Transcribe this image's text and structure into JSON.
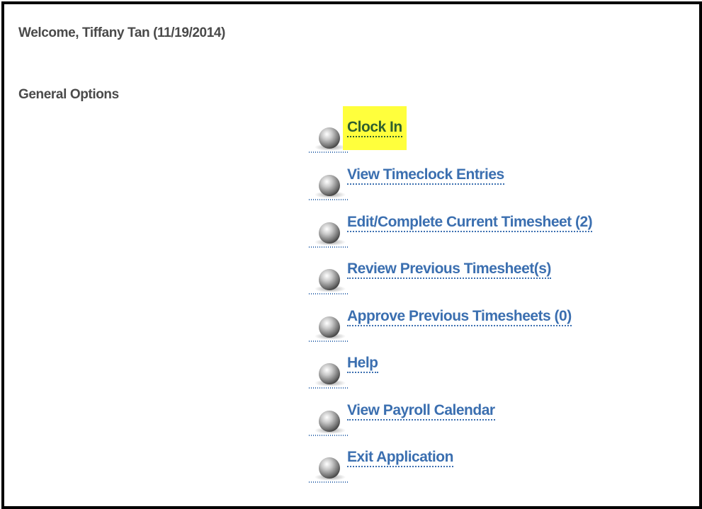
{
  "header": {
    "welcome": "Welcome, Tiffany Tan (11/19/2014)"
  },
  "general_options": {
    "title": "General Options",
    "items": [
      {
        "label": "Clock In",
        "highlighted": true
      },
      {
        "label": "View Timeclock Entries",
        "highlighted": false
      },
      {
        "label": "Edit/Complete Current Timesheet (2)",
        "highlighted": false
      },
      {
        "label": "Review Previous Timesheet(s)",
        "highlighted": false
      },
      {
        "label": "Approve Previous Timesheets (0)",
        "highlighted": false
      },
      {
        "label": "Help",
        "highlighted": false
      },
      {
        "label": "View Payroll Calendar",
        "highlighted": false
      },
      {
        "label": "Exit Application",
        "highlighted": false
      }
    ]
  },
  "icons": {
    "bullet": "sphere-bullet-icon"
  },
  "colors": {
    "link": "#3b6fb0",
    "highlight": "#ffff3c",
    "heading": "#4a4a4a",
    "border": "#000000"
  }
}
